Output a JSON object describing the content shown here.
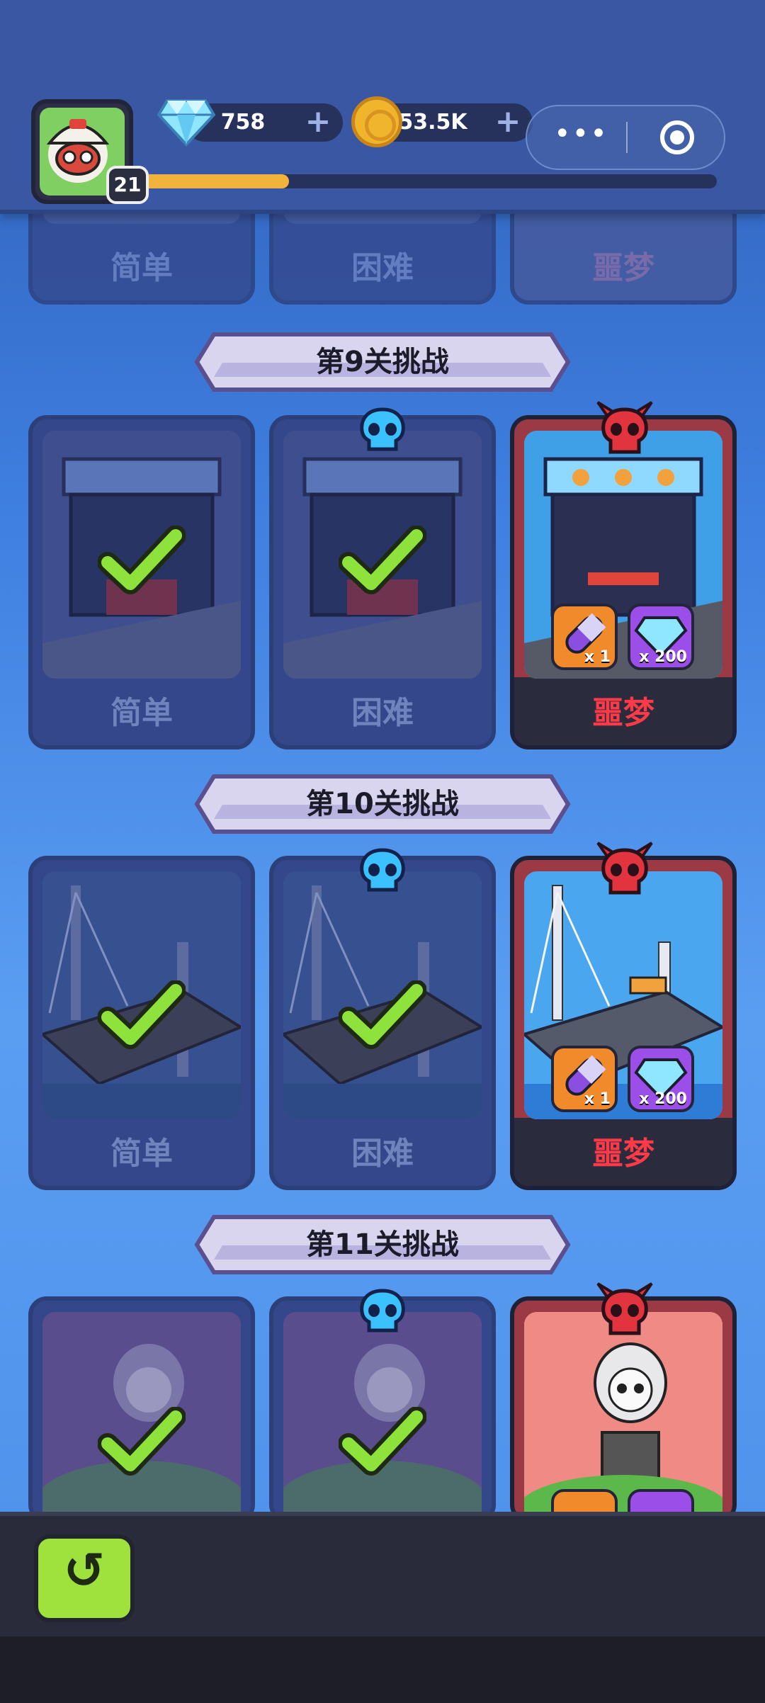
{
  "player": {
    "level": "21",
    "xp_progress": 0.26
  },
  "currency": {
    "gems": {
      "value": "758",
      "icon": "diamond-icon"
    },
    "coins": {
      "value": "53.5K",
      "icon": "coin-icon"
    }
  },
  "mini_program": {
    "more_icon": "more-dots-icon",
    "close_icon": "target-icon"
  },
  "difficulty_labels": {
    "easy": "简单",
    "hard": "困难",
    "nightmare": "噩梦"
  },
  "challenges": [
    {
      "title": "第9关挑战",
      "theme": "shop",
      "rewards": [
        {
          "icon": "capsule-pill-icon",
          "count": "x 1"
        },
        {
          "icon": "diamond-icon",
          "count": "x 200"
        }
      ]
    },
    {
      "title": "第10关挑战",
      "theme": "bridge",
      "rewards": [
        {
          "icon": "capsule-pill-icon",
          "count": "x 1"
        },
        {
          "icon": "diamond-icon",
          "count": "x 200"
        }
      ]
    },
    {
      "title": "第11关挑战",
      "theme": "reaper"
    }
  ],
  "colors": {
    "accent_green": "#9fe23e",
    "nightmare_red": "#ff3a48",
    "xp_bar": "#f2b33b"
  },
  "back_button": {
    "icon": "back-arrow-icon",
    "glyph": "↺"
  }
}
